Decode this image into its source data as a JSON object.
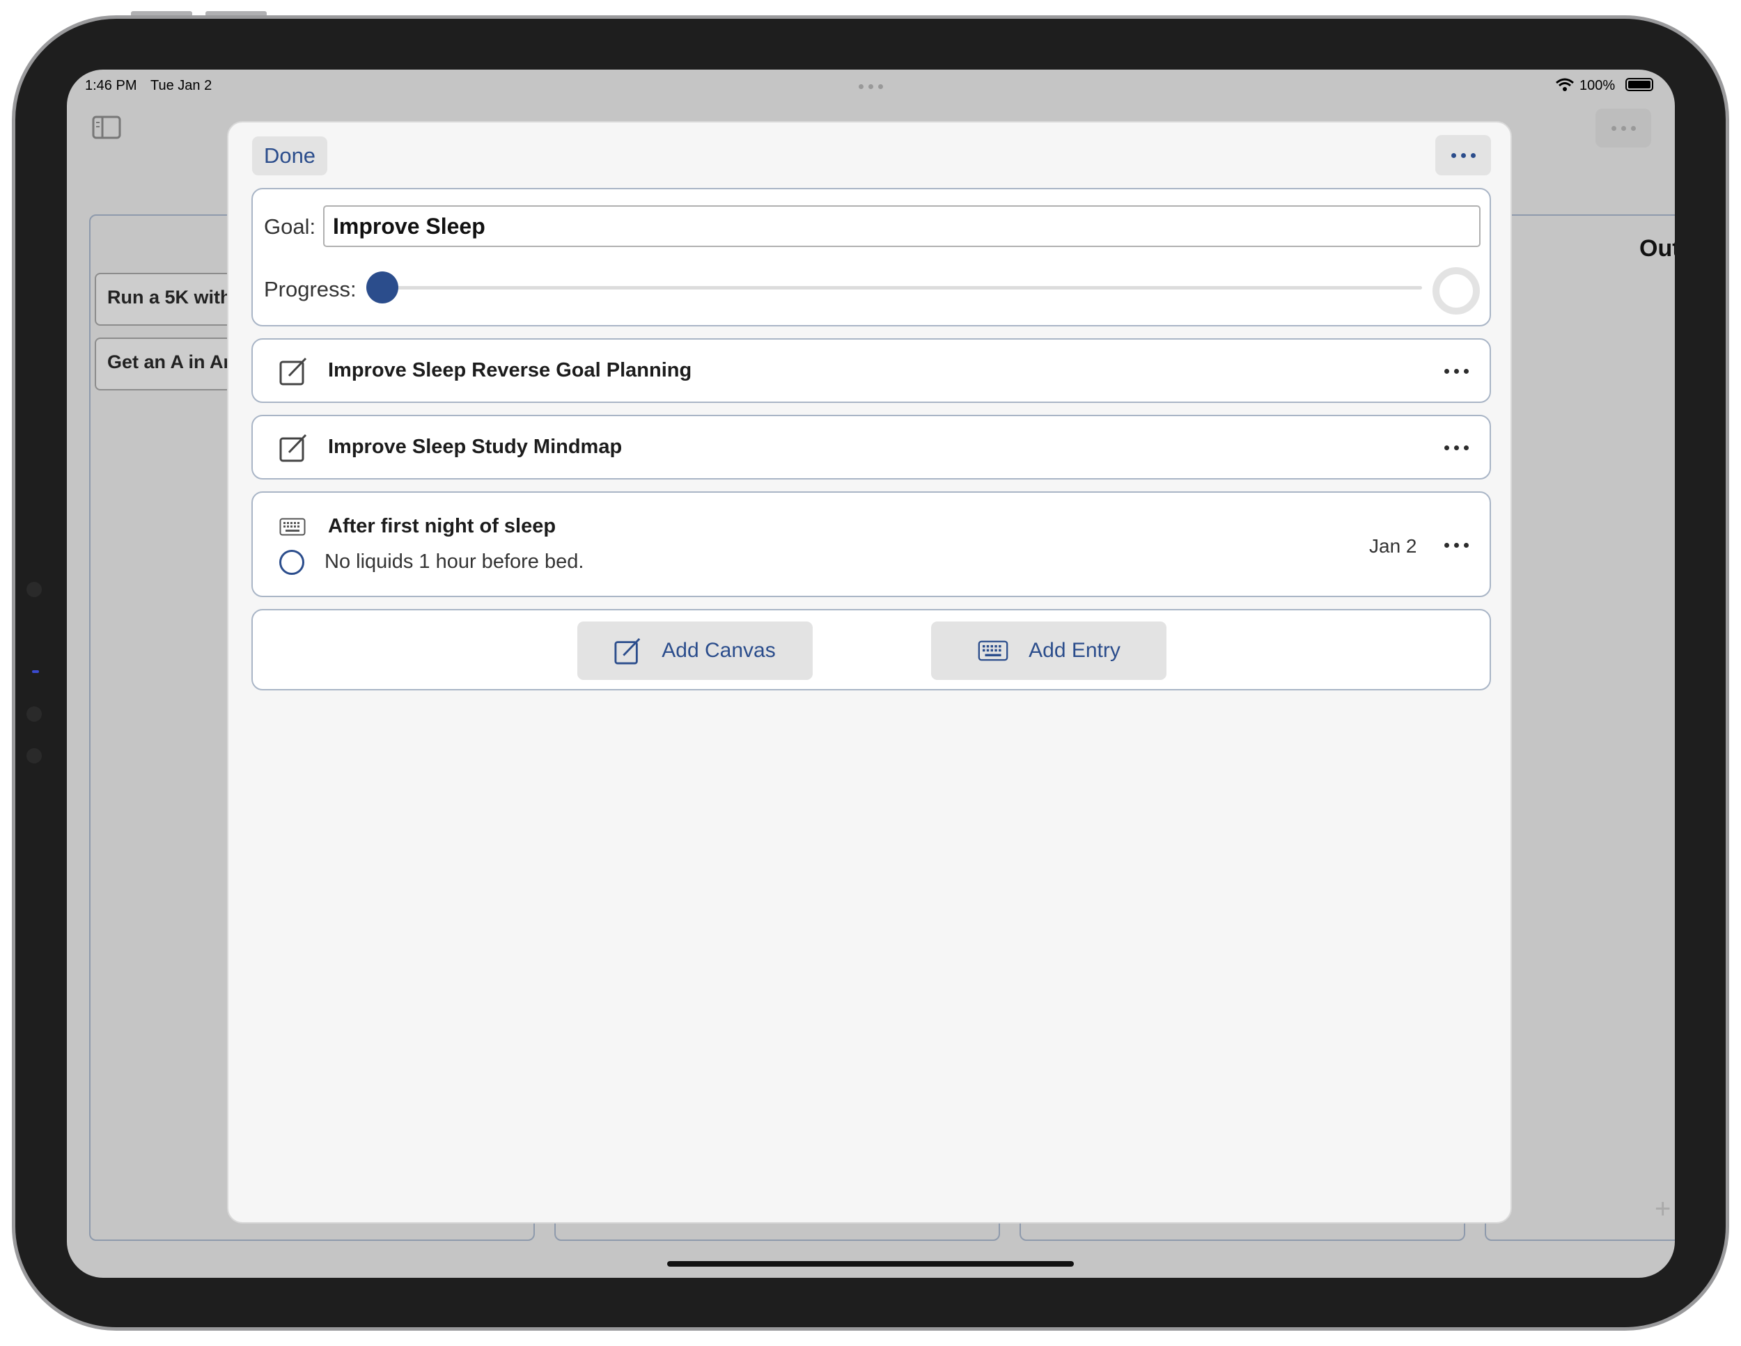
{
  "status_bar": {
    "time": "1:46 PM",
    "date": "Tue Jan 2",
    "battery": "100%"
  },
  "background": {
    "column_heading": "Out",
    "goals": [
      "Run a 5K with",
      "Get an A in Ar"
    ]
  },
  "modal": {
    "done_label": "Done",
    "goal_label": "Goal:",
    "goal_value": "Improve Sleep",
    "progress_label": "Progress:",
    "progress_value": 0
  },
  "items": [
    {
      "type": "canvas",
      "icon": "compose-icon",
      "title": "Improve Sleep Reverse Goal Planning"
    },
    {
      "type": "canvas",
      "icon": "compose-icon",
      "title": "Improve Sleep Study Mindmap"
    },
    {
      "type": "entry",
      "icon": "keyboard-icon",
      "title": "After first night of sleep",
      "task": "No liquids 1 hour before bed.",
      "date": "Jan 2"
    }
  ],
  "actions": {
    "add_canvas_label": "Add Canvas",
    "add_entry_label": "Add Entry"
  },
  "colors": {
    "accent": "#2b4d8c",
    "slider_thumb": "#2b4d8c",
    "card_border": "#a9b5c6"
  }
}
